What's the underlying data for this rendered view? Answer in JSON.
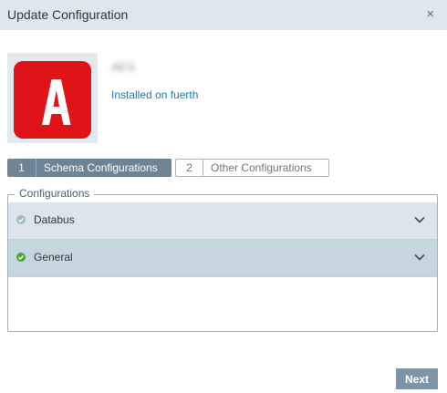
{
  "dialog": {
    "title": "Update Configuration",
    "close_glyph": "×"
  },
  "app": {
    "name": "AES",
    "installed_text": "Installed on fuerth",
    "icon_letter": "A",
    "icon_color": "#e01418"
  },
  "steps": [
    {
      "number": "1",
      "label": "Schema Configurations",
      "active": true
    },
    {
      "number": "2",
      "label": "Other Configurations",
      "active": false
    }
  ],
  "configurations": {
    "legend": "Configurations",
    "items": [
      {
        "label": "Databus",
        "status": "pending",
        "status_color": "#9fb8c5"
      },
      {
        "label": "General",
        "status": "complete",
        "status_color": "#47a82f"
      }
    ]
  },
  "footer": {
    "next_label": "Next"
  },
  "icons": {
    "close": "close-icon",
    "status": "check-circle-icon",
    "expand": "chevron-down-icon"
  }
}
